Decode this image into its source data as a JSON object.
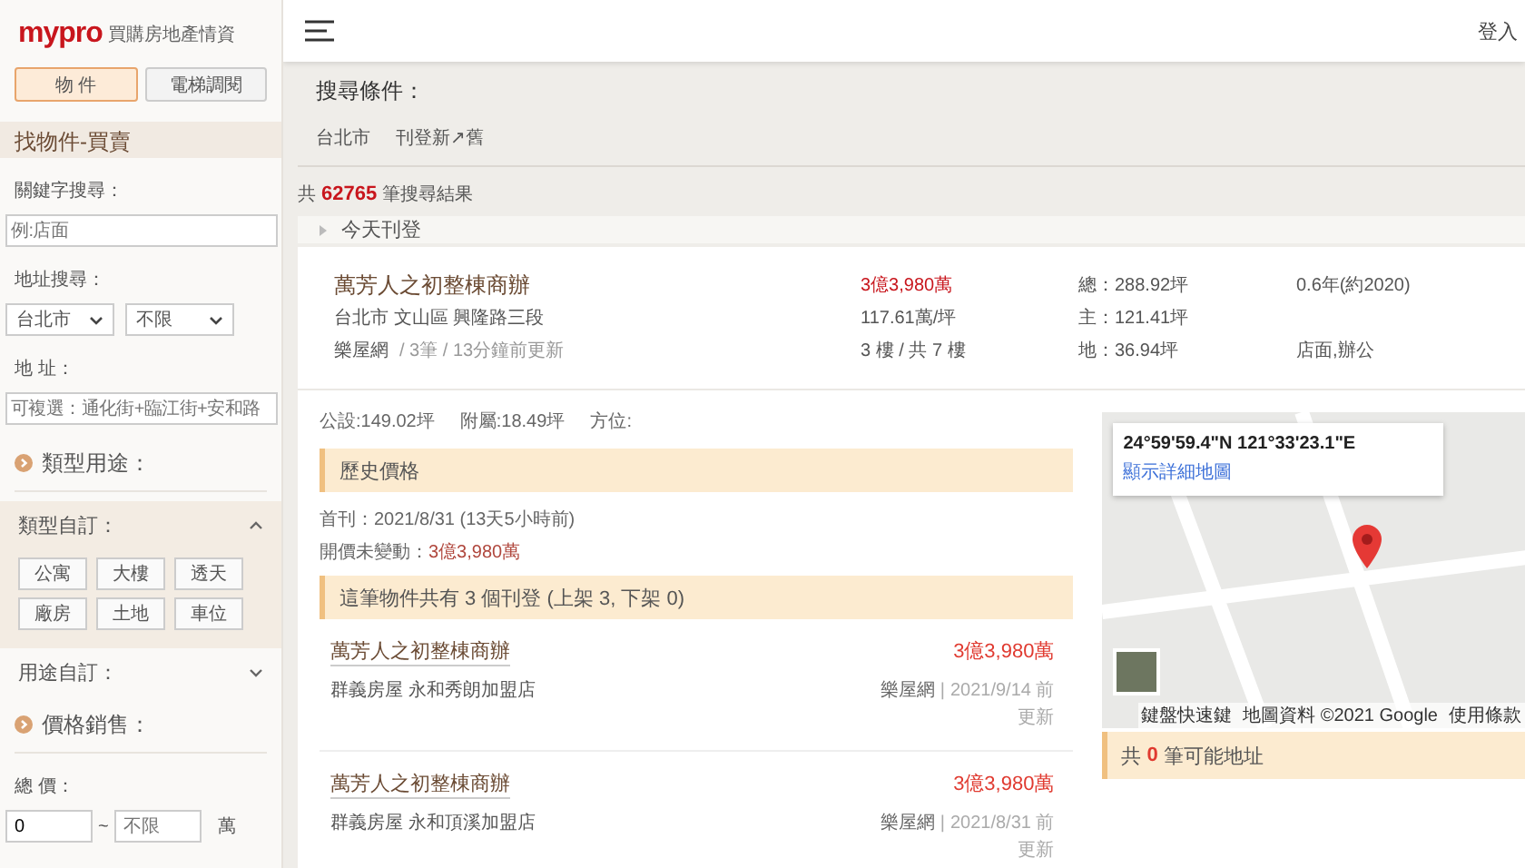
{
  "sidebar": {
    "logo": "mypro",
    "tagline": "買購房地產情資",
    "tabs": [
      {
        "label": "物 件",
        "selected": true
      },
      {
        "label": "電梯調閱",
        "selected": false
      }
    ],
    "section_title": "找物件-買賣",
    "keyword": {
      "label": "關鍵字搜尋：",
      "placeholder": "例:店面"
    },
    "address_search": {
      "label": "地址搜尋：",
      "city": "台北市",
      "district": "不限"
    },
    "address": {
      "label": "地 址：",
      "placeholder": "可複選：通化街+臨江街+安和路"
    },
    "type_usage_heading": "類型用途：",
    "type_custom": {
      "label": "類型自訂：",
      "expanded": true,
      "options": [
        "公寓",
        "大樓",
        "透天",
        "廠房",
        "土地",
        "車位"
      ]
    },
    "usage_custom": {
      "label": "用途自訂：",
      "expanded": false
    },
    "price_heading": "價格銷售：",
    "total_price": {
      "label": "總 價：",
      "min_value": "0",
      "separator": "~",
      "max_placeholder": "不限",
      "unit": "萬"
    }
  },
  "header": {
    "login": "登入"
  },
  "search_conditions": {
    "title": "搜尋條件：",
    "tags": [
      "台北市",
      "刊登新↗舊"
    ]
  },
  "results": {
    "prefix": "共",
    "count": "62765",
    "suffix": "筆搜尋結果"
  },
  "group": {
    "label": "今天刊登"
  },
  "listing": {
    "title": "萬芳人之初整棟商辦",
    "address": "台北市 文山區 興隆路三段",
    "source": "樂屋網",
    "meta": "/ 3筆 / 13分鐘前更新",
    "price": "3億3,980萬",
    "unit_price": "117.61萬/坪",
    "floor": "3 樓 / 共 7 樓",
    "total_area": "總：288.92坪",
    "main_area": "主：121.41坪",
    "land_area": "地：36.94坪",
    "age": "0.6年(約2020)",
    "usage": "店面,辦公"
  },
  "detail": {
    "areas": [
      "公設:149.02坪",
      "附屬:18.49坪",
      "方位:"
    ],
    "history_title": "歷史價格",
    "first_listed": "首刊：2021/8/31 (13天5小時前)",
    "price_change_label": "開價未變動：",
    "price_change_value": "3億3,980萬",
    "listings_summary": "這筆物件共有 3 個刊登 (上架 3, 下架 0)",
    "listings": [
      {
        "title": "萬芳人之初整棟商辦",
        "agency": "群義房屋 永和秀朗加盟店",
        "price": "3億3,980萬",
        "source": "樂屋網",
        "separator": "|",
        "date": "2021/9/14 前更新"
      },
      {
        "title": "萬芳人之初整棟商辦",
        "agency": "群義房屋 永和頂溪加盟店",
        "price": "3億3,980萬",
        "source": "樂屋網",
        "separator": "|",
        "date": "2021/8/31 前更新"
      }
    ]
  },
  "map": {
    "coordinates": "24°59'59.4\"N 121°33'23.1\"E",
    "link": "顯示詳細地圖",
    "attribution": [
      "鍵盤快速鍵",
      "地圖資料 ©2021 Google",
      "使用條款"
    ]
  },
  "possible_addresses": {
    "prefix": "共",
    "count": "0",
    "suffix": "筆可能地址"
  }
}
